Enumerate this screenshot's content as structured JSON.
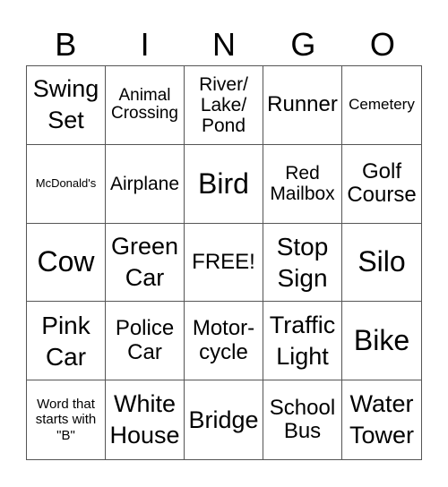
{
  "header": [
    "B",
    "I",
    "N",
    "G",
    "O"
  ],
  "cells": [
    "Swing Set",
    "Animal Crossing",
    "River/ Lake/ Pond",
    "Runner",
    "Cemetery",
    "McDonald's",
    "Airplane",
    "Bird",
    "Red Mailbox",
    "Golf Course",
    "Cow",
    "Green Car",
    "FREE!",
    "Stop Sign",
    "Silo",
    "Pink Car",
    "Police Car",
    "Motor-cycle",
    "Traffic Light",
    "Bike",
    "Word that starts with \"B\"",
    "White House",
    "Bridge",
    "School Bus",
    "Water Tower"
  ]
}
